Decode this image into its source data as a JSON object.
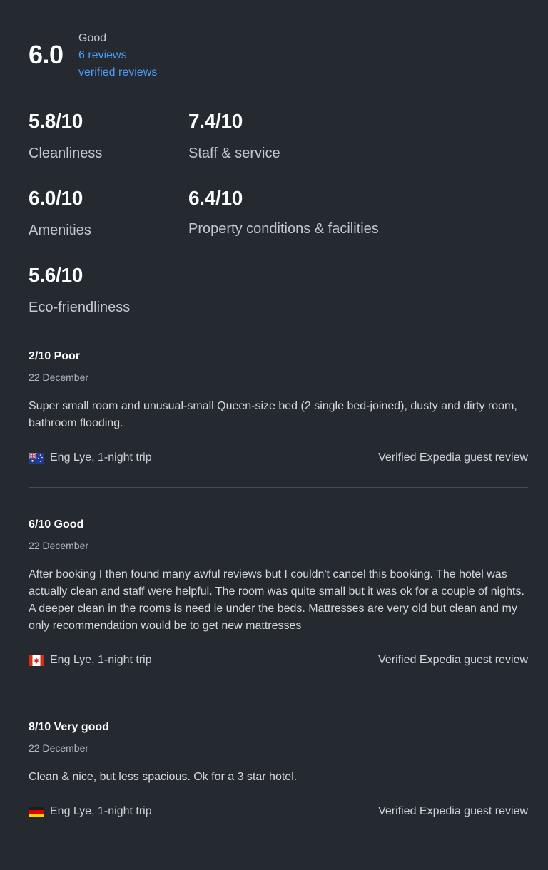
{
  "overall": {
    "score": "6.0",
    "label": "Good",
    "reviews_link": "6 reviews",
    "verified_link": "verified reviews"
  },
  "ratings": [
    {
      "value": "5.8/10",
      "name": "Cleanliness"
    },
    {
      "value": "7.4/10",
      "name": "Staff & service"
    },
    {
      "value": "6.0/10",
      "name": "Amenities"
    },
    {
      "value": "6.4/10",
      "name": "Property conditions & facilities"
    },
    {
      "value": "5.6/10",
      "name": "Eco-friendliness"
    }
  ],
  "reviews": [
    {
      "title": "2/10 Poor",
      "date": "22 December",
      "text": "Super small room and unusual-small Queen-size bed (2 single bed-joined), dusty and dirty room, bathroom flooding.",
      "author": "Eng Lye, 1-night trip",
      "flag": "australia-flag-icon",
      "verified": "Verified Expedia guest review"
    },
    {
      "title": "6/10 Good",
      "date": "22 December",
      "text": "After booking I then found many awful reviews but I couldn't cancel this booking. The hotel was actually clean and staff were helpful. The room was quite small but it was ok for a couple of nights. A deeper clean in the rooms is need ie under the beds. Mattresses are very old but clean and my only recommendation would be to get new mattresses",
      "author": "Eng Lye, 1-night trip",
      "flag": "canada-flag-icon",
      "verified": "Verified Expedia guest review"
    },
    {
      "title": "8/10 Very good",
      "date": "22 December",
      "text": "Clean & nice, but less spacious. Ok for a 3 star hotel.",
      "author": "Eng Lye, 1-night trip",
      "flag": "germany-flag-icon",
      "verified": "Verified Expedia guest review"
    }
  ],
  "colors": {
    "background": "#252a31",
    "link": "#4c9df8",
    "divider": "#464b53"
  }
}
